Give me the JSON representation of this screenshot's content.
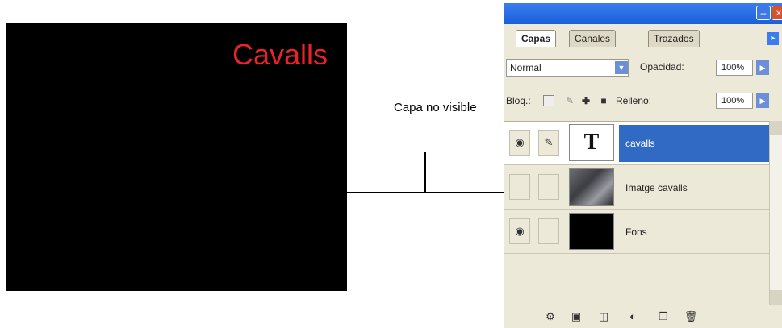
{
  "canvas": {
    "text": "Cavalls",
    "text_color": "#e8232b"
  },
  "callout": {
    "label": "Capa no visible"
  },
  "panel": {
    "tabs": [
      "Capas",
      "Canales",
      "Trazados"
    ],
    "blend_mode": "Normal",
    "opacity_label": "Opacidad:",
    "opacity_value": "100%",
    "lock_label": "Bloq.:",
    "fill_label": "Relleno:",
    "fill_value": "100%",
    "layers": [
      {
        "name": "cavalls",
        "visible": true,
        "selected": true,
        "thumbnail": "T"
      },
      {
        "name": "Imatge cavalls",
        "visible": false,
        "selected": false,
        "thumbnail": "photo"
      },
      {
        "name": "Fons",
        "visible": true,
        "selected": false,
        "thumbnail": "black"
      }
    ],
    "accent": "#316ac5"
  }
}
